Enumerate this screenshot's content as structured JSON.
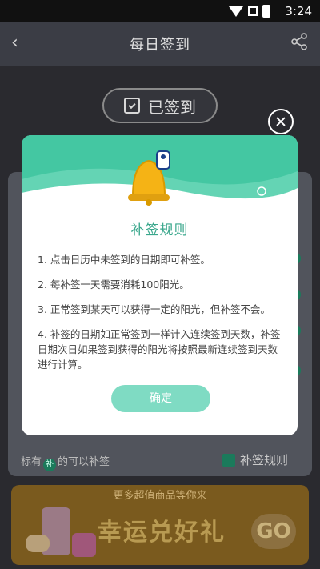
{
  "statusbar": {
    "time": "3:24"
  },
  "header": {
    "title": "每日签到",
    "back_icon": "chevron-left-icon",
    "share_icon": "share-icon"
  },
  "signin": {
    "status_label": "已签到"
  },
  "modal": {
    "title": "补签规则",
    "rules": [
      "1. 点击日历中未签到的日期即可补签。",
      "2. 每补签一天需要消耗100阳光。",
      "3. 正常签到某天可以获得一定的阳光，但补签不会。",
      "4. 补签的日期如正常签到一样计入连续签到天数，补签日期次日如果签到获得的阳光将按照最新连续签到天数进行计算。"
    ],
    "confirm_label": "确定"
  },
  "calendar_footer": {
    "hint_prefix": "标有",
    "hint_badge": "补",
    "hint_suffix": "的可以补签",
    "rules_link": "补签规则"
  },
  "banner": {
    "subtitle": "更多超值商品等你来",
    "title": "幸运兑好礼",
    "go_label": "GO"
  },
  "colors": {
    "accent": "#44c7a2",
    "confirm": "#7fdbc3",
    "overlay_bg": "#2a2a2f"
  }
}
